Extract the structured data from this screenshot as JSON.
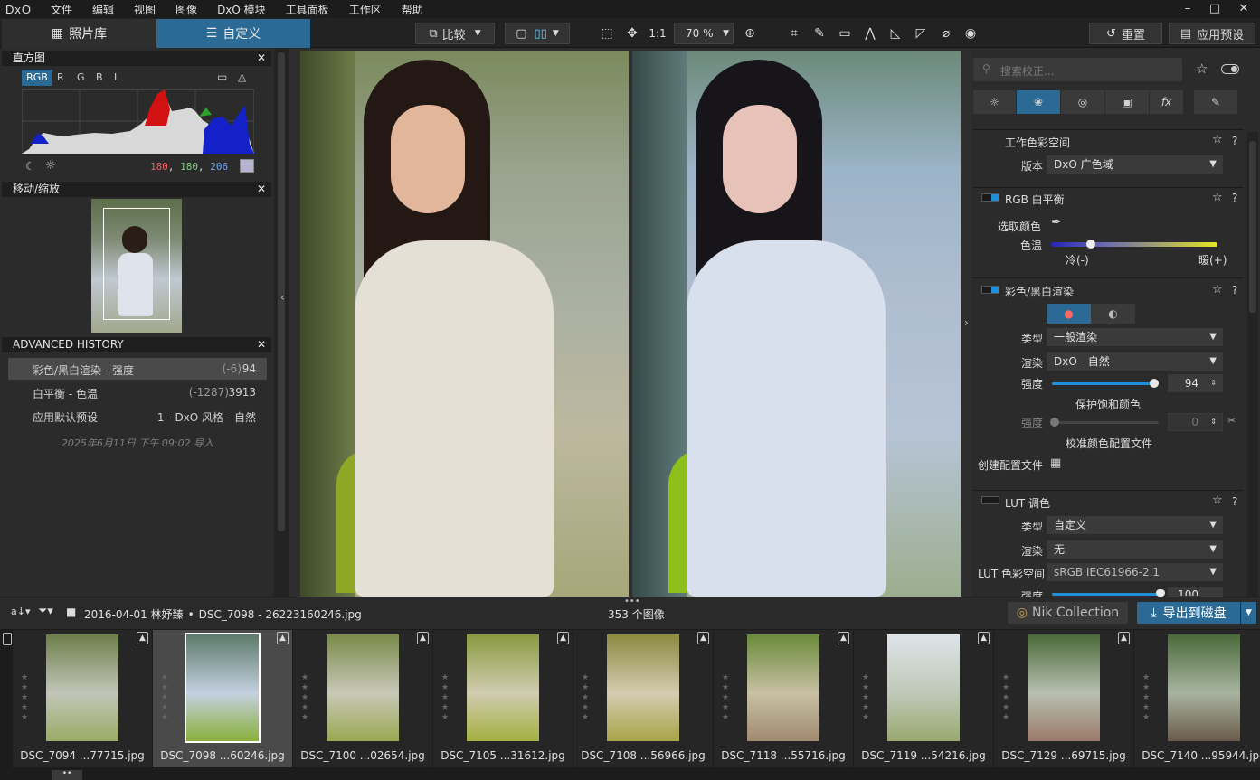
{
  "menubar": {
    "logo": "DxO",
    "items": [
      "文件",
      "编辑",
      "视图",
      "图像",
      "DxO 模块",
      "工具面板",
      "工作区",
      "帮助"
    ]
  },
  "tabs": {
    "library": "照片库",
    "customize": "自定义"
  },
  "toolbar": {
    "compare": "比较",
    "zoom_one": "1:1",
    "zoom": "70 %",
    "reset": "重置",
    "apply_preset": "应用预设"
  },
  "histogram": {
    "title": "直方图",
    "channels": [
      "RGB",
      "R",
      "G",
      "B",
      "L"
    ],
    "r": "180",
    "g": "180",
    "b": "206"
  },
  "navigator": {
    "title": "移动/缩放"
  },
  "history": {
    "title": "ADVANCED HISTORY",
    "items": [
      {
        "label": "彩色/黑白渲染 - 强度",
        "delta": "(-6)",
        "value": "94"
      },
      {
        "label": "白平衡 - 色温",
        "delta": "(-1287)",
        "value": "3913"
      },
      {
        "label": "应用默认预设",
        "delta": "",
        "value": "1 - DxO 风格 - 自然"
      }
    ],
    "imported": "2025年6月11日 下午 09:02 导入"
  },
  "search": {
    "placeholder": "搜索校正..."
  },
  "right": {
    "workspace": {
      "title": "工作色彩空间",
      "version_label": "版本",
      "version": "DxO 广色域"
    },
    "wb": {
      "title": "RGB 白平衡",
      "picker": "选取颜色",
      "temp": "色温",
      "cold": "冷(-)",
      "warm": "暖(+)"
    },
    "render": {
      "title": "彩色/黑白渲染",
      "type_label": "类型",
      "type": "一般渲染",
      "render_label": "渲染",
      "render": "DxO - 自然",
      "strength_label": "强度",
      "strength": "94",
      "protect": "保护饱和颜色",
      "strength2_label": "强度",
      "strength2": "0",
      "calib": "校准颜色配置文件",
      "create": "创建配置文件"
    },
    "lut": {
      "title": "LUT 调色",
      "type_label": "类型",
      "type": "自定义",
      "render_label": "渲染",
      "render": "无",
      "space_label": "LUT 色彩空间",
      "space": "sRGB IEC61966-2.1",
      "strength_label": "强度",
      "strength": "100"
    }
  },
  "filmstrip": {
    "path": "2016-04-01 林妤臻",
    "file": "DSC_7098 - 26223160246.jpg",
    "count": "353 个图像",
    "nik": "Nik Collection",
    "export": "导出到磁盘",
    "thumbs": [
      "DSC_7094 ...77715.jpg",
      "DSC_7098 ...60246.jpg",
      "DSC_7100 ...02654.jpg",
      "DSC_7105 ...31612.jpg",
      "DSC_7108 ...56966.jpg",
      "DSC_7118 ...55716.jpg",
      "DSC_7119 ...54216.jpg",
      "DSC_7129 ...69715.jpg",
      "DSC_7140 ...95944.jpg"
    ]
  },
  "colors": {
    "accent": "#1e8fd8",
    "panel": "#2b2b2b",
    "selected_tab": "#2b6a95"
  }
}
